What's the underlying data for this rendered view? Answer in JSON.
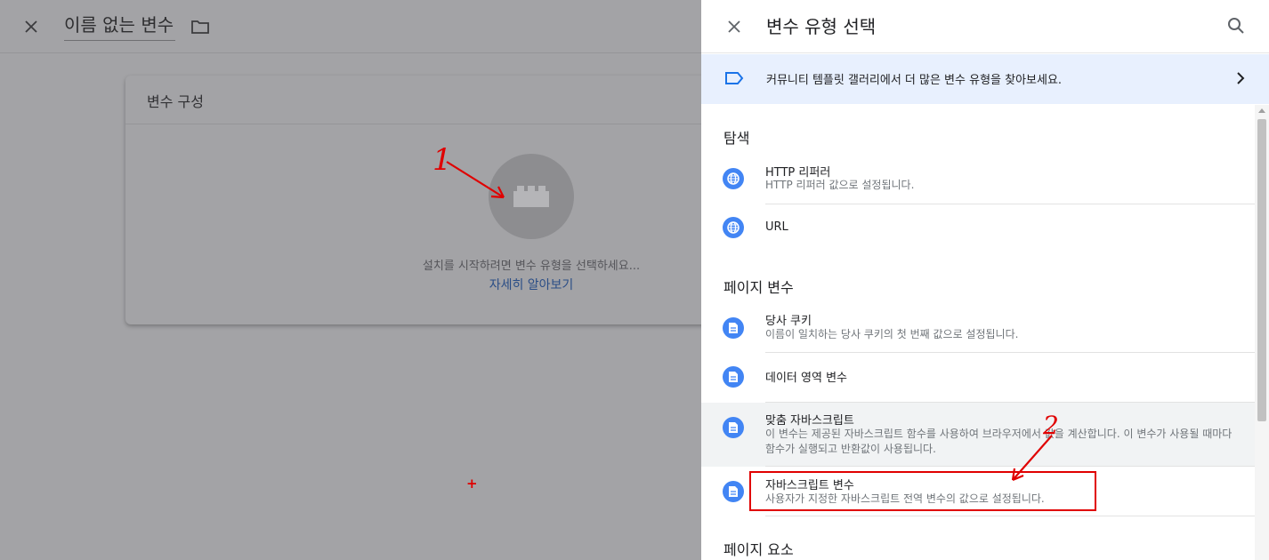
{
  "editor": {
    "title": "이름 없는 변수",
    "card_title": "변수 구성",
    "hint": "설치를 시작하려면 변수 유형을 선택하세요...",
    "learn_more": "자세히 알아보기"
  },
  "annotations": {
    "step1": "1",
    "step2": "2",
    "plus": "+"
  },
  "panel": {
    "title": "변수 유형 선택",
    "banner": "커뮤니티 템플릿 갤러리에서 더 많은 변수 유형을 찾아보세요.",
    "sections": [
      {
        "title": "탐색",
        "items": [
          {
            "title": "HTTP 리퍼러",
            "desc": "HTTP 리퍼러 값으로 설정됩니다.",
            "icon": "globe-icon"
          },
          {
            "title": "URL",
            "desc": "",
            "icon": "globe-icon"
          }
        ]
      },
      {
        "title": "페이지 변수",
        "items": [
          {
            "title": "당사 쿠키",
            "desc": "이름이 일치하는 당사 쿠키의 첫 번째 값으로 설정됩니다.",
            "icon": "document-icon"
          },
          {
            "title": "데이터 영역 변수",
            "desc": "",
            "icon": "document-icon"
          },
          {
            "title": "맞춤 자바스크립트",
            "desc": "이 변수는 제공된 자바스크립트 함수를 사용하여 브라우저에서 값을 계산합니다. 이 변수가 사용될 때마다 함수가 실행되고 반환값이 사용됩니다.",
            "icon": "document-icon"
          },
          {
            "title": "자바스크립트 변수",
            "desc": "사용자가 지정한 자바스크립트 전역 변수의 값으로 설정됩니다.",
            "icon": "document-icon"
          }
        ]
      },
      {
        "title": "페이지 요소",
        "items": []
      }
    ]
  },
  "colors": {
    "accent": "#4285f4",
    "banner_bg": "#e8f0fe",
    "annotation": "#e00000",
    "dim_overlay": "#a3a3a6"
  }
}
